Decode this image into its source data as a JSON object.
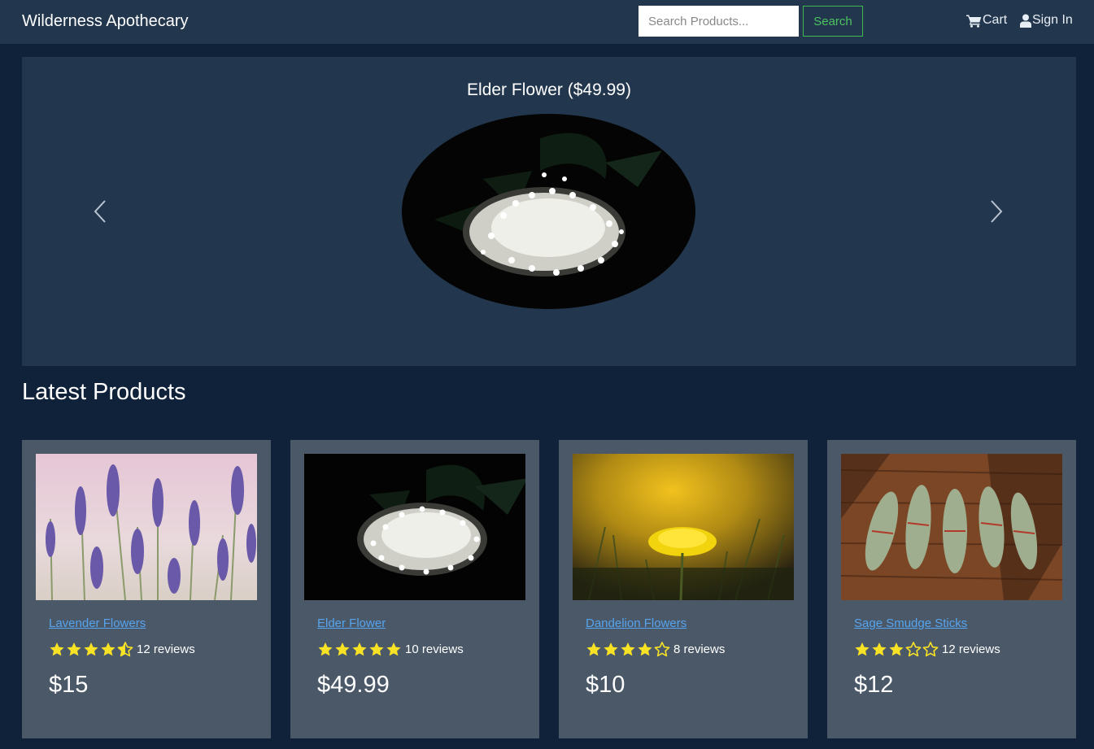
{
  "navbar": {
    "brand": "Wilderness Apothecary",
    "search_placeholder": "Search Products...",
    "search_button": "Search",
    "cart_label": "Cart",
    "signin_label": "Sign In"
  },
  "carousel": {
    "caption": "Elder Flower ($49.99)",
    "prev_icon": "chevron-left-icon",
    "next_icon": "chevron-right-icon"
  },
  "section_title": "Latest Products",
  "colors": {
    "navbar_bg": "#22364d",
    "page_bg": "#10223a",
    "card_bg": "#4a5868",
    "link": "#56a4ee",
    "star": "#f8e225",
    "search_accent": "#3fb950"
  },
  "products": [
    {
      "name": "Lavender Flowers",
      "rating": 4.5,
      "reviews": "12 reviews",
      "price": "$15"
    },
    {
      "name": "Elder Flower",
      "rating": 5,
      "reviews": "10 reviews",
      "price": "$49.99"
    },
    {
      "name": "Dandelion Flowers",
      "rating": 4,
      "reviews": "8 reviews",
      "price": "$10"
    },
    {
      "name": "Sage Smudge Sticks",
      "rating": 3,
      "reviews": "12 reviews",
      "price": "$12"
    }
  ]
}
